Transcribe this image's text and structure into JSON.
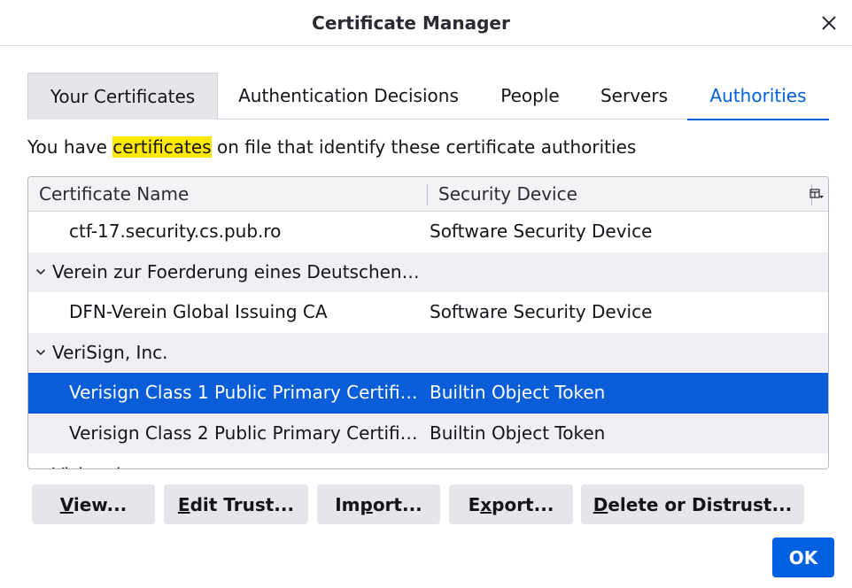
{
  "window": {
    "title": "Certificate Manager"
  },
  "tabs": [
    {
      "label": "Your Certificates"
    },
    {
      "label": "Authentication Decisions"
    },
    {
      "label": "People"
    },
    {
      "label": "Servers"
    },
    {
      "label": "Authorities"
    }
  ],
  "selected_tab": "Authorities",
  "description": {
    "before": "You have ",
    "highlight": "certificates",
    "after": " on file that identify these certificate authorities"
  },
  "tree": {
    "columns": {
      "name": "Certificate Name",
      "device": "Security Device"
    },
    "rows": [
      {
        "name": "ctf-17.security.cs.pub.ro",
        "device": "Software Security Device",
        "group": false
      },
      {
        "name": "Verein zur Foerderung eines Deutschen…",
        "device": "",
        "group": true
      },
      {
        "name": "DFN-Verein Global Issuing CA",
        "device": "Software Security Device",
        "group": false
      },
      {
        "name": "VeriSign, Inc.",
        "device": "",
        "group": true
      },
      {
        "name": "Verisign Class 1 Public Primary Certifi…",
        "device": "Builtin Object Token",
        "group": false,
        "selected": true
      },
      {
        "name": "Verisign Class 2 Public Primary Certifi…",
        "device": "Builtin Object Token",
        "group": false
      }
    ],
    "partial_row": "Visionaire"
  },
  "buttons": {
    "view": {
      "pre": "",
      "key": "V",
      "post": "iew..."
    },
    "edit_trust": {
      "pre": "",
      "key": "E",
      "post": "dit Trust..."
    },
    "import": {
      "pre": "Im",
      "key": "p",
      "post": "ort..."
    },
    "export": {
      "pre": "E",
      "key": "x",
      "post": "port..."
    },
    "delete": {
      "pre": "",
      "key": "D",
      "post": "elete or Distrust..."
    },
    "ok": "OK"
  },
  "colors": {
    "accent": "#0061e0",
    "selection": "#0a5dd9",
    "highlight": "#ffe900"
  },
  "icons": {
    "close": "close-icon",
    "twisty": "chevron-down-icon",
    "column_picker": "column-picker-icon"
  }
}
